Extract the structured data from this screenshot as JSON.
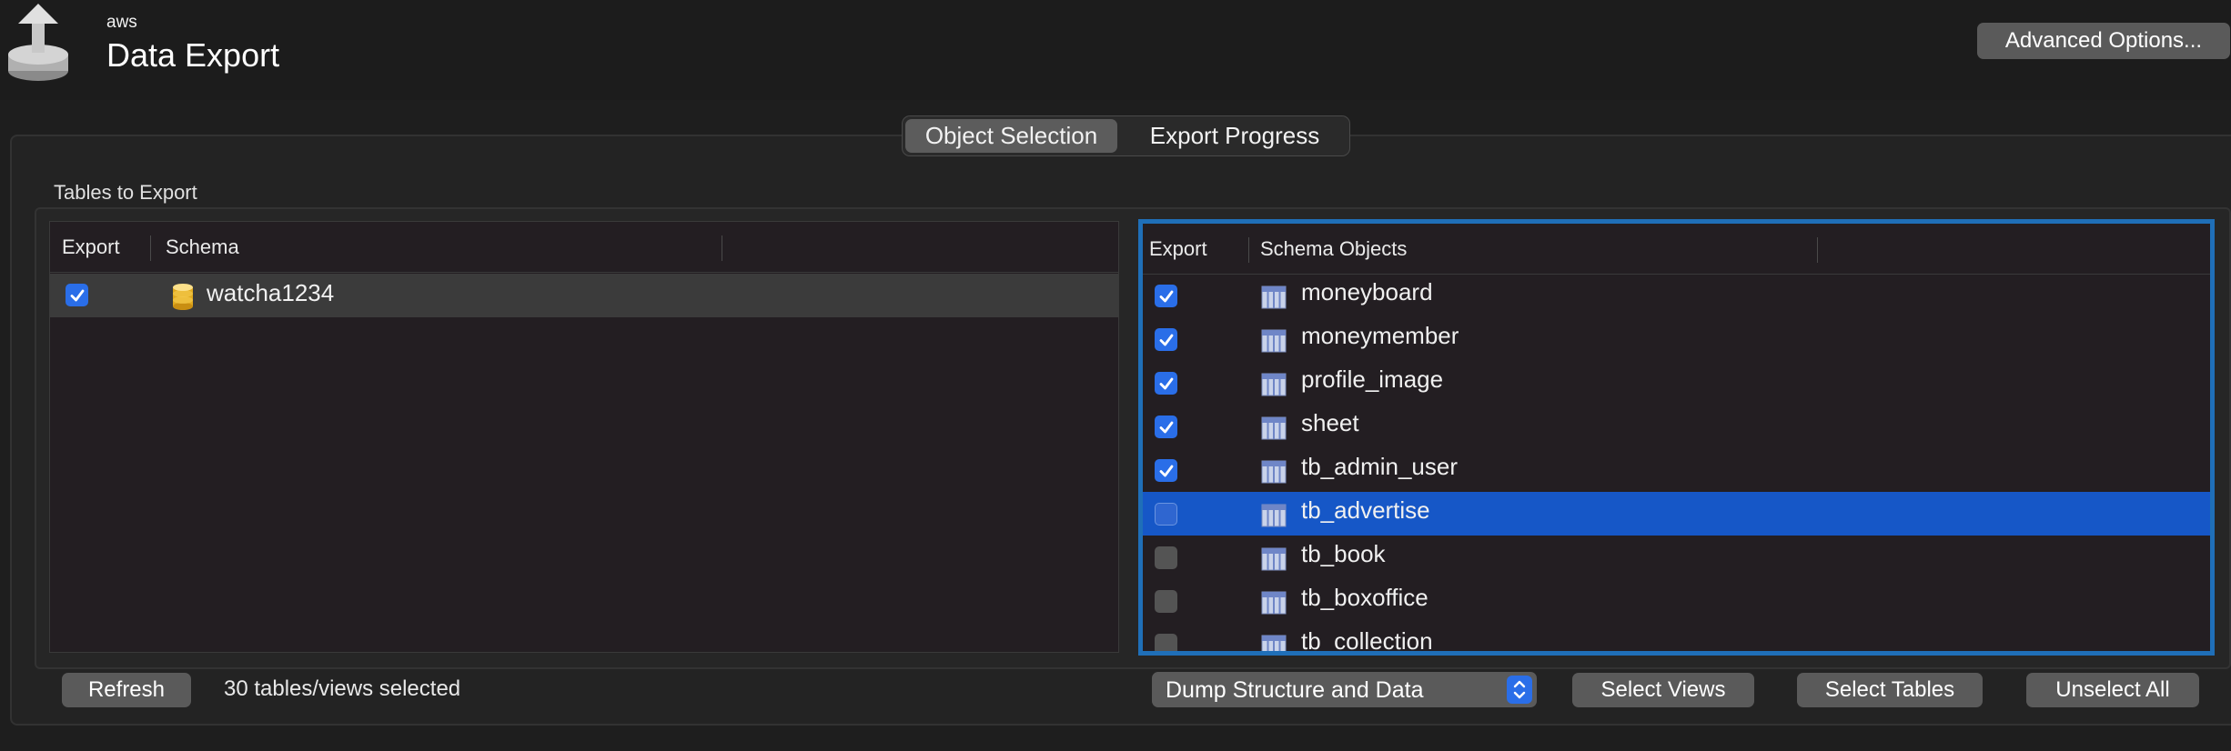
{
  "header": {
    "subtitle": "aws",
    "title": "Data Export",
    "advanced_button": "Advanced Options..."
  },
  "tabs": [
    {
      "label": "Object Selection",
      "active": true
    },
    {
      "label": "Export Progress",
      "active": false
    }
  ],
  "section_label": "Tables to Export",
  "left_table": {
    "columns": [
      "Export",
      "Schema"
    ],
    "rows": [
      {
        "checked": true,
        "name": "watcha1234"
      }
    ]
  },
  "right_table": {
    "columns": [
      "Export",
      "Schema Objects"
    ],
    "rows": [
      {
        "checked": true,
        "name": "moneyboard"
      },
      {
        "checked": true,
        "name": "moneymember"
      },
      {
        "checked": true,
        "name": "profile_image"
      },
      {
        "checked": true,
        "name": "sheet"
      },
      {
        "checked": true,
        "name": "tb_admin_user"
      },
      {
        "checked": false,
        "name": "tb_advertise",
        "selected": true
      },
      {
        "checked": false,
        "name": "tb_book"
      },
      {
        "checked": false,
        "name": "tb_boxoffice"
      },
      {
        "checked": false,
        "name": "tb_collection"
      }
    ]
  },
  "footer": {
    "refresh_button": "Refresh",
    "status": "30 tables/views selected",
    "dump_select": "Dump Structure and Data",
    "select_views_button": "Select Views",
    "select_tables_button": "Select Tables",
    "unselect_all_button": "Unselect All"
  },
  "colors": {
    "accent": "#2a6ee8",
    "selection": "#1657c7",
    "focus_ring": "#1f6fb8"
  }
}
